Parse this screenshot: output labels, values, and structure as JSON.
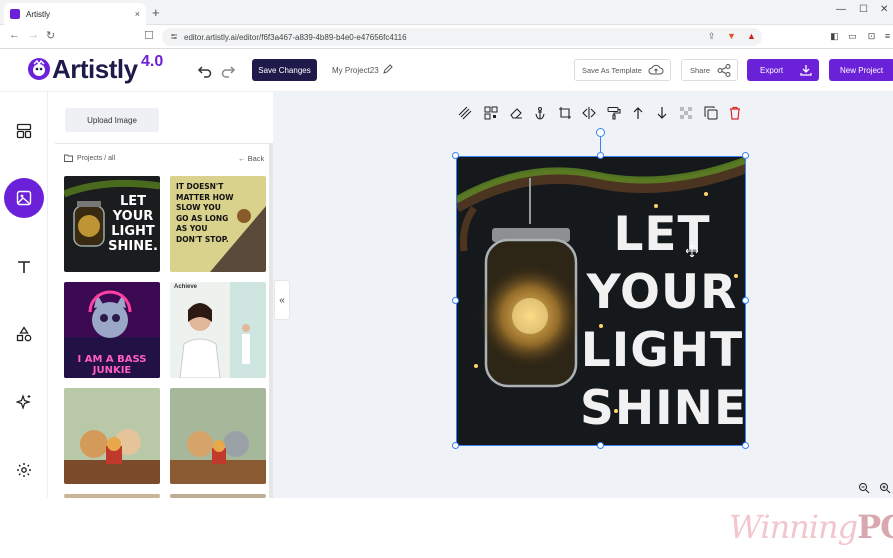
{
  "browser": {
    "tab_title": "Artistly",
    "tab_close": "×",
    "new_tab": "+",
    "url": "editor.artistly.ai/editor/f6f3a467-a839-4b89-b4e0-e47656fc4116"
  },
  "header": {
    "logo_text": "Artistly",
    "logo_version": "4.0",
    "save_changes": "Save Changes",
    "project_name": "My Project23",
    "save_as_template": "Save As Template",
    "share": "Share",
    "export": "Export",
    "new_project": "New Project"
  },
  "sidebar": {
    "items": [
      {
        "name": "layout",
        "icon": "layout-icon"
      },
      {
        "name": "image",
        "icon": "image-icon",
        "active": true
      },
      {
        "name": "text",
        "icon": "text-icon"
      },
      {
        "name": "shapes",
        "icon": "shapes-icon"
      },
      {
        "name": "ai",
        "icon": "sparkle-icon"
      },
      {
        "name": "settings",
        "icon": "gear-icon"
      }
    ]
  },
  "panel": {
    "upload_image": "Upload Image",
    "breadcrumb": "Projects / all",
    "back": "Back",
    "collapse": "«",
    "thumbnails": [
      {
        "title": "LET YOUR LIGHT SHINE."
      },
      {
        "title": "IT DOESN'T MATTER HOW SLOW YOU GO AS LONG AS YOU DON'T STOP."
      },
      {
        "title": "I AM A BASS JUNKIE"
      },
      {
        "title": "Achieve"
      },
      {
        "title": ""
      },
      {
        "title": ""
      }
    ]
  },
  "canvas": {
    "artboard_text": [
      "LET",
      "YOUR",
      "LIGHT",
      "SHINE."
    ]
  },
  "watermark": {
    "part1": "Winning",
    "part2": "PC"
  },
  "colors": {
    "brand_purple": "#6b21d8",
    "navy": "#1e1b4b",
    "selection_blue": "#3b82f6",
    "delete_red": "#dc2626"
  }
}
